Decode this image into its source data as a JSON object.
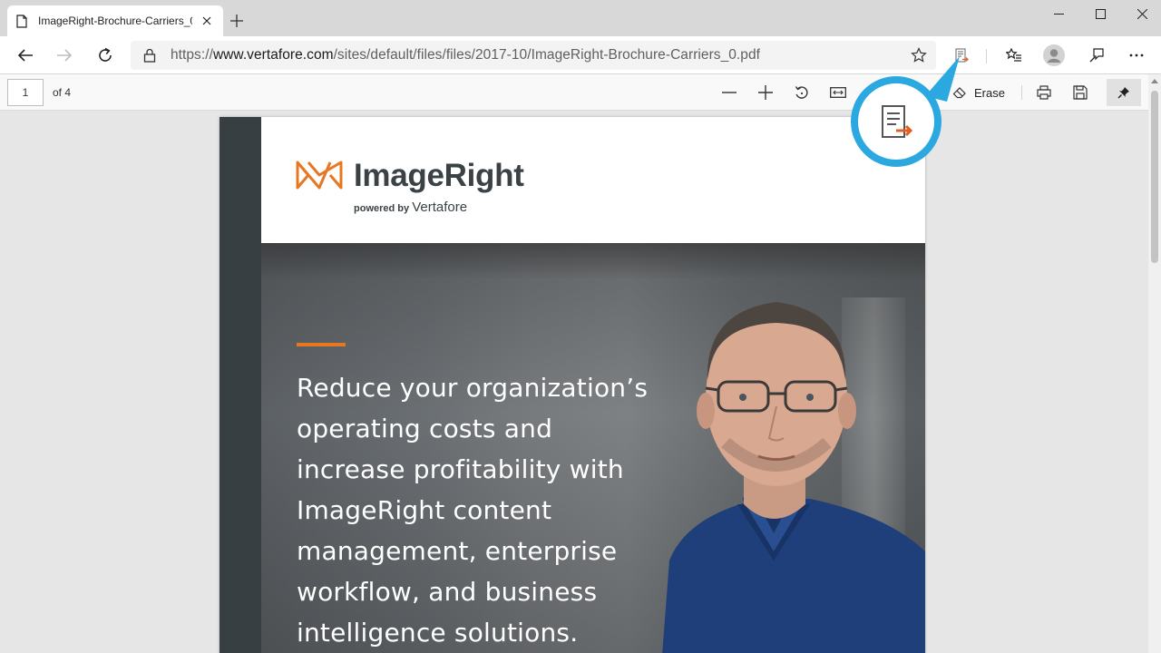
{
  "browser": {
    "tab": {
      "title": "ImageRight-Brochure-Carriers_0.pdf"
    },
    "address": {
      "url_prefix": "https://",
      "url_host": "www.vertafore.com",
      "url_path": "/sites/default/files/files/2017-10/ImageRight-Brochure-Carriers_0.pdf"
    }
  },
  "pdf_toolbar": {
    "page_number": "1",
    "page_of": "of 4",
    "erase_label": "Erase"
  },
  "document": {
    "logo_name": "ImageRight",
    "logo_powered_by": "powered by",
    "logo_brand": "Vertafore",
    "headline_lines": [
      "Reduce your organization’s",
      "operating costs and",
      "increase profitability with",
      "ImageRight content",
      "management, enterprise",
      "workflow, and business",
      "intelligence solutions."
    ]
  },
  "colors": {
    "accent_orange": "#e87722",
    "callout_blue": "#2aa8df",
    "sidebar_dark": "#373f43"
  },
  "icons": [
    "document-icon",
    "close-icon",
    "plus-icon",
    "minimize-icon",
    "maximize-icon",
    "window-close-icon",
    "back-arrow-icon",
    "forward-arrow-icon",
    "refresh-icon",
    "lock-icon",
    "star-icon",
    "read-aloud-icon",
    "favorites-icon",
    "profile-icon",
    "feedback-icon",
    "more-icon",
    "zoom-out-icon",
    "zoom-in-icon",
    "rotate-icon",
    "fit-page-icon",
    "eraser-icon",
    "print-icon",
    "save-icon",
    "pin-icon"
  ]
}
